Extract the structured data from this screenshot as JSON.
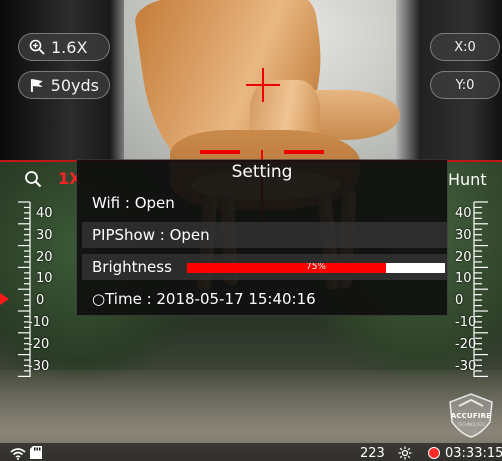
{
  "pip": {
    "zoom": "1.6X",
    "range": "50yds",
    "x_coord": "X:0",
    "y_coord": "Y:0"
  },
  "main": {
    "zoom_label": "1X",
    "mode_label": "Hunt"
  },
  "scale": {
    "left_labels": [
      "40",
      "30",
      "20",
      "10",
      "0",
      "-10",
      "-20",
      "-30"
    ],
    "right_labels": [
      "40",
      "30",
      "20",
      "10",
      "0",
      "-10",
      "-20",
      "-30"
    ],
    "accent_color": "#ff1a1a"
  },
  "dialog": {
    "title": "Setting",
    "wifi": "Wifi : Open",
    "pipshow": "PIPShow : Open",
    "brightness_label": "Brightness",
    "brightness_value": "75%",
    "brightness_level": 0.77,
    "time": "○Time : 2018-05-17  15:40:16"
  },
  "status": {
    "count": "223",
    "timer": "03:33:15"
  },
  "logo": {
    "name": "ACCUFIRE",
    "sub": "TECHNOLOGY"
  },
  "icons": {
    "wifi": "wifi-icon",
    "sd": "sd-card-icon",
    "sun": "brightness-icon",
    "record": "record-icon",
    "zoom": "zoom-in-icon",
    "range": "flag-icon",
    "search": "search-icon"
  }
}
